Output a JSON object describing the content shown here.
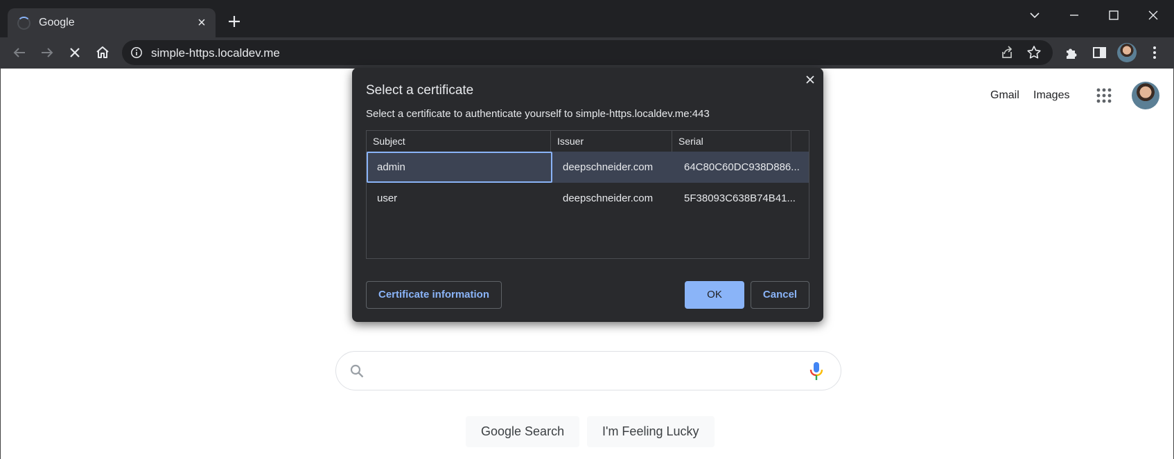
{
  "browser": {
    "tab_title": "Google",
    "url": "simple-https.localdev.me"
  },
  "page": {
    "gmail_link": "Gmail",
    "images_link": "Images",
    "google_search_button": "Google Search",
    "feeling_lucky_button": "I'm Feeling Lucky"
  },
  "dialog": {
    "title": "Select a certificate",
    "description": "Select a certificate to authenticate yourself to simple-https.localdev.me:443",
    "columns": [
      "Subject",
      "Issuer",
      "Serial"
    ],
    "rows": [
      {
        "subject": "admin",
        "issuer": "deepschneider.com",
        "serial": "64C80C60DC938D886...",
        "selected": true
      },
      {
        "subject": "user",
        "issuer": "deepschneider.com",
        "serial": "5F38093C638B74B41...",
        "selected": false
      }
    ],
    "cert_info_button": "Certificate information",
    "ok_button": "OK",
    "cancel_button": "Cancel"
  },
  "colors": {
    "chrome_dark": "#202124",
    "toolbar": "#35363a",
    "dialog_bg": "#292a2d",
    "accent": "#8ab4f8",
    "selected_row": "#3c4353"
  }
}
